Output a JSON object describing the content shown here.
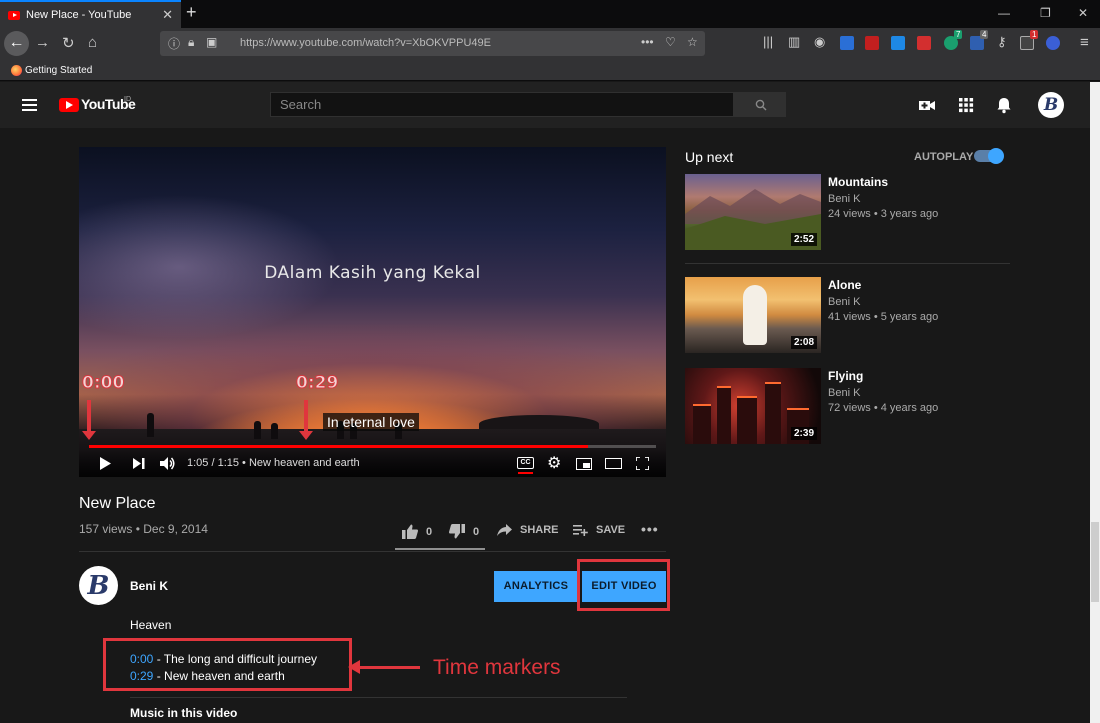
{
  "browser": {
    "tab_title": "New Place - YouTube",
    "tab_close": "✕",
    "new_tab": "+",
    "url": "https://www.youtube.com/watch?v=XbOKVPPU49E",
    "bookmark_label": "Getting Started",
    "badges": {
      "green": "7",
      "blue": "4",
      "red": "1"
    },
    "window_min": "—",
    "window_restore": "❐",
    "window_close": "✕"
  },
  "youtube": {
    "logo_text": "YouTube",
    "logo_sup": "ID",
    "search_placeholder": "Search",
    "avatar_letter": "B"
  },
  "player": {
    "overlay_title": "DAlam Kasih yang Kekal",
    "subtitle": "In eternal love",
    "time_display": "1:05 / 1:15 • New heaven and earth",
    "progress_fraction": 0.88,
    "annotation_start": "0:00",
    "annotation_mid": "0:29"
  },
  "video": {
    "title": "New Place",
    "meta": "157 views • Dec 9, 2014",
    "likes": "0",
    "dislikes": "0",
    "share": "SHARE",
    "save": "SAVE"
  },
  "owner": {
    "name": "Beni K",
    "avatar_letter": "B",
    "analytics_label": "ANALYTICS",
    "edit_label": "EDIT VIDEO"
  },
  "description": {
    "heading": "Heaven",
    "markers": [
      {
        "time": "0:00",
        "text": " - The long and difficult journey"
      },
      {
        "time": "0:29",
        "text": " - New heaven and earth"
      }
    ],
    "music_heading": "Music in this video"
  },
  "annotation": {
    "callout": "Time markers",
    "color": "#e0363d"
  },
  "sidebar": {
    "up_next": "Up next",
    "autoplay": "AUTOPLAY",
    "videos": [
      {
        "title": "Mountains",
        "channel": "Beni K",
        "meta": "24 views • 3 years ago",
        "duration": "2:52"
      },
      {
        "title": "Alone",
        "channel": "Beni K",
        "meta": "41 views • 5 years ago",
        "duration": "2:08"
      },
      {
        "title": "Flying",
        "channel": "Beni K",
        "meta": "72 views • 4 years ago",
        "duration": "2:39"
      }
    ]
  },
  "colors": {
    "accent": "#3ea6ff",
    "brand": "#ff0000"
  }
}
